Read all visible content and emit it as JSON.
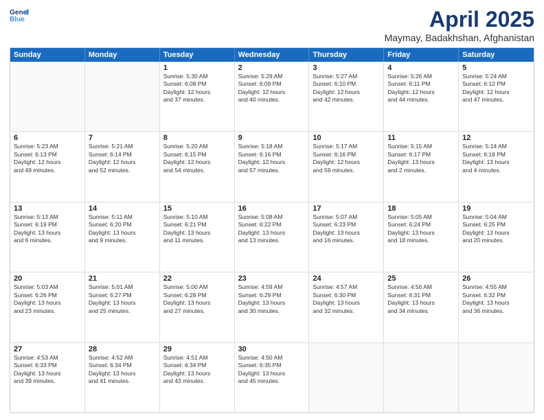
{
  "header": {
    "logo_line1": "General",
    "logo_line2": "Blue",
    "title": "April 2025",
    "subtitle": "Maymay, Badakhshan, Afghanistan"
  },
  "weekdays": [
    "Sunday",
    "Monday",
    "Tuesday",
    "Wednesday",
    "Thursday",
    "Friday",
    "Saturday"
  ],
  "rows": [
    [
      {
        "day": "",
        "info": ""
      },
      {
        "day": "",
        "info": ""
      },
      {
        "day": "1",
        "info": "Sunrise: 5:30 AM\nSunset: 6:08 PM\nDaylight: 12 hours\nand 37 minutes."
      },
      {
        "day": "2",
        "info": "Sunrise: 5:29 AM\nSunset: 6:09 PM\nDaylight: 12 hours\nand 40 minutes."
      },
      {
        "day": "3",
        "info": "Sunrise: 5:27 AM\nSunset: 6:10 PM\nDaylight: 12 hours\nand 42 minutes."
      },
      {
        "day": "4",
        "info": "Sunrise: 5:26 AM\nSunset: 6:11 PM\nDaylight: 12 hours\nand 44 minutes."
      },
      {
        "day": "5",
        "info": "Sunrise: 5:24 AM\nSunset: 6:12 PM\nDaylight: 12 hours\nand 47 minutes."
      }
    ],
    [
      {
        "day": "6",
        "info": "Sunrise: 5:23 AM\nSunset: 6:13 PM\nDaylight: 12 hours\nand 49 minutes."
      },
      {
        "day": "7",
        "info": "Sunrise: 5:21 AM\nSunset: 6:14 PM\nDaylight: 12 hours\nand 52 minutes."
      },
      {
        "day": "8",
        "info": "Sunrise: 5:20 AM\nSunset: 6:15 PM\nDaylight: 12 hours\nand 54 minutes."
      },
      {
        "day": "9",
        "info": "Sunrise: 5:18 AM\nSunset: 6:16 PM\nDaylight: 12 hours\nand 57 minutes."
      },
      {
        "day": "10",
        "info": "Sunrise: 5:17 AM\nSunset: 6:16 PM\nDaylight: 12 hours\nand 59 minutes."
      },
      {
        "day": "11",
        "info": "Sunrise: 5:15 AM\nSunset: 6:17 PM\nDaylight: 13 hours\nand 2 minutes."
      },
      {
        "day": "12",
        "info": "Sunrise: 5:14 AM\nSunset: 6:18 PM\nDaylight: 13 hours\nand 4 minutes."
      }
    ],
    [
      {
        "day": "13",
        "info": "Sunrise: 5:13 AM\nSunset: 6:19 PM\nDaylight: 13 hours\nand 6 minutes."
      },
      {
        "day": "14",
        "info": "Sunrise: 5:11 AM\nSunset: 6:20 PM\nDaylight: 13 hours\nand 9 minutes."
      },
      {
        "day": "15",
        "info": "Sunrise: 5:10 AM\nSunset: 6:21 PM\nDaylight: 13 hours\nand 11 minutes."
      },
      {
        "day": "16",
        "info": "Sunrise: 5:08 AM\nSunset: 6:22 PM\nDaylight: 13 hours\nand 13 minutes."
      },
      {
        "day": "17",
        "info": "Sunrise: 5:07 AM\nSunset: 6:23 PM\nDaylight: 13 hours\nand 16 minutes."
      },
      {
        "day": "18",
        "info": "Sunrise: 5:05 AM\nSunset: 6:24 PM\nDaylight: 13 hours\nand 18 minutes."
      },
      {
        "day": "19",
        "info": "Sunrise: 5:04 AM\nSunset: 6:25 PM\nDaylight: 13 hours\nand 20 minutes."
      }
    ],
    [
      {
        "day": "20",
        "info": "Sunrise: 5:03 AM\nSunset: 6:26 PM\nDaylight: 13 hours\nand 23 minutes."
      },
      {
        "day": "21",
        "info": "Sunrise: 5:01 AM\nSunset: 6:27 PM\nDaylight: 13 hours\nand 25 minutes."
      },
      {
        "day": "22",
        "info": "Sunrise: 5:00 AM\nSunset: 6:28 PM\nDaylight: 13 hours\nand 27 minutes."
      },
      {
        "day": "23",
        "info": "Sunrise: 4:59 AM\nSunset: 6:29 PM\nDaylight: 13 hours\nand 30 minutes."
      },
      {
        "day": "24",
        "info": "Sunrise: 4:57 AM\nSunset: 6:30 PM\nDaylight: 13 hours\nand 32 minutes."
      },
      {
        "day": "25",
        "info": "Sunrise: 4:56 AM\nSunset: 6:31 PM\nDaylight: 13 hours\nand 34 minutes."
      },
      {
        "day": "26",
        "info": "Sunrise: 4:55 AM\nSunset: 6:32 PM\nDaylight: 13 hours\nand 36 minutes."
      }
    ],
    [
      {
        "day": "27",
        "info": "Sunrise: 4:53 AM\nSunset: 6:33 PM\nDaylight: 13 hours\nand 39 minutes."
      },
      {
        "day": "28",
        "info": "Sunrise: 4:52 AM\nSunset: 6:34 PM\nDaylight: 13 hours\nand 41 minutes."
      },
      {
        "day": "29",
        "info": "Sunrise: 4:51 AM\nSunset: 6:34 PM\nDaylight: 13 hours\nand 43 minutes."
      },
      {
        "day": "30",
        "info": "Sunrise: 4:50 AM\nSunset: 6:35 PM\nDaylight: 13 hours\nand 45 minutes."
      },
      {
        "day": "",
        "info": ""
      },
      {
        "day": "",
        "info": ""
      },
      {
        "day": "",
        "info": ""
      }
    ]
  ]
}
